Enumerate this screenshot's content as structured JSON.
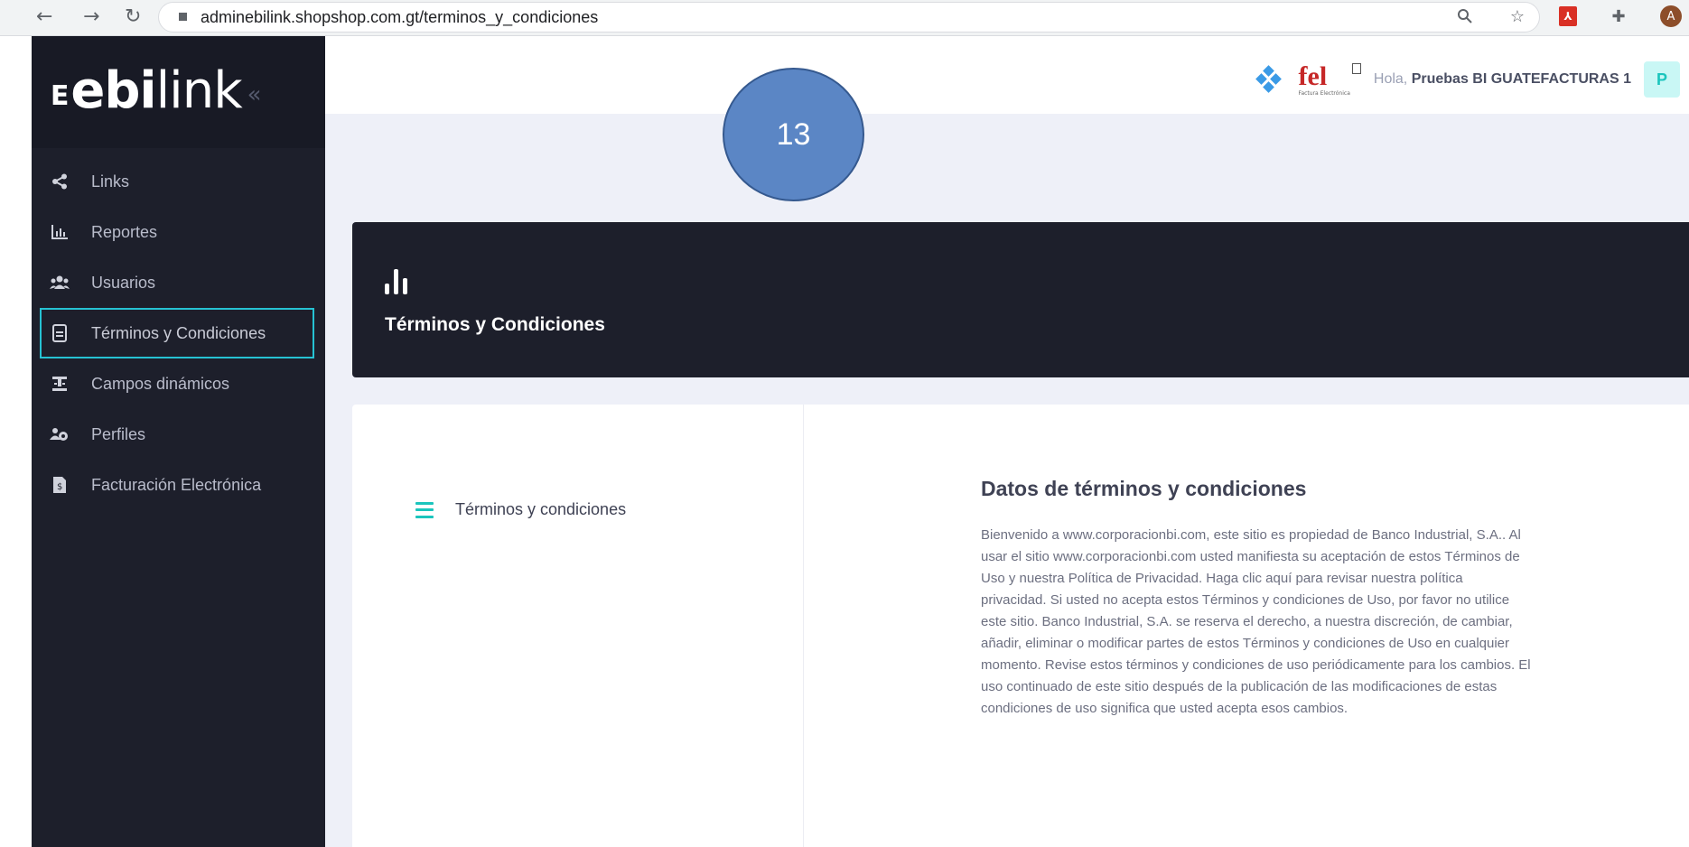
{
  "browser": {
    "url": "adminebilink.shopshop.com.gt/terminos_y_condiciones",
    "nav": {
      "back": "←",
      "forward": "→",
      "reload": "↻"
    },
    "profile_initial": "A"
  },
  "sidebar": {
    "logo": {
      "bold": "ebi",
      "thin": "link",
      "collapse": "«"
    },
    "items": [
      {
        "label": "Links",
        "icon": "share-icon"
      },
      {
        "label": "Reportes",
        "icon": "chart-icon"
      },
      {
        "label": "Usuarios",
        "icon": "users-icon"
      },
      {
        "label": "Términos y Condiciones",
        "icon": "document-icon",
        "active": true
      },
      {
        "label": "Campos dinámicos",
        "icon": "fields-icon"
      },
      {
        "label": "Perfiles",
        "icon": "profiles-icon"
      },
      {
        "label": "Facturación Electrónica",
        "icon": "invoice-icon"
      }
    ]
  },
  "header": {
    "greeting_prefix": "Hola,",
    "user_name": "Pruebas BI GUATEFACTURAS 1",
    "user_initial": "P",
    "fel_logo": "fel",
    "fel_caption": "Factura Electrónica"
  },
  "annotation": {
    "step": "13"
  },
  "banner": {
    "title": "Términos y Condiciones"
  },
  "card": {
    "left_item": "Términos y condiciones",
    "section_title": "Datos de términos y condiciones",
    "section_body": "Bienvenido a www.corporacionbi.com, este sitio es propiedad de Banco Industrial, S.A.. Al usar el sitio www.corporacionbi.com usted manifiesta su aceptación de estos Términos de Uso y nuestra Política de Privacidad. Haga clic aquí para revisar nuestra política privacidad. Si usted no acepta estos Términos y condiciones de Uso, por favor no utilice este sitio. Banco Industrial, S.A. se reserva el derecho, a nuestra discreción, de cambiar, añadir, eliminar o modificar partes de estos Términos y condiciones de Uso en cualquier momento. Revise estos términos y condiciones de uso periódicamente para los cambios. El uso continuado de este sitio después de la publicación de las modificaciones de estas condiciones de uso significa que usted acepta esos cambios."
  },
  "colors": {
    "sidebar_bg": "#1d1f2b",
    "active_outline": "#26c2d3",
    "accent_teal": "#1bc5bd",
    "step_circle": "#5b86c5"
  }
}
